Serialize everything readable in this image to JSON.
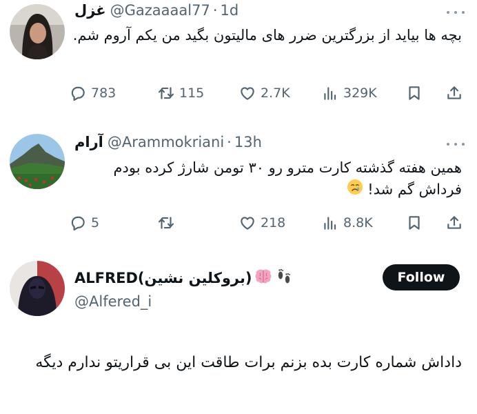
{
  "tweets": [
    {
      "display_name": "غزل",
      "handle": "@Gazaaaal77",
      "separator": "·",
      "time": "1d",
      "text": "بچه ها بیاید از بزرگترین ضرر های مالیتون بگید من یکم آروم شم.",
      "replies": "783",
      "retweets": "115",
      "likes": "2.7K",
      "views": "329K"
    },
    {
      "display_name": "آرام",
      "handle": "@Arammokriani",
      "separator": "·",
      "time": "13h",
      "text": "همین هفته گذشته کارت مترو رو ۳۰ تومن شارژ کرده بودم فرداش گم شد!",
      "emoji_name": "crying-face",
      "replies": "5",
      "retweets": "",
      "likes": "218",
      "views": "8.8K"
    }
  ],
  "main_tweet": {
    "display_name": "ALFRED(بروکلین نشین)",
    "name_emojis": [
      "brain-icon",
      "footprints-icon"
    ],
    "handle": "@Alfered_i",
    "follow_label": "Follow",
    "text": "داداش شماره کارت بده بزنم برات طاقت این بی قراریتو ندارم دیگه"
  },
  "colors": {
    "text_primary": "#0f1419",
    "text_secondary": "#536471",
    "follow_bg": "#0f1419",
    "divider": "#cfd9de"
  }
}
